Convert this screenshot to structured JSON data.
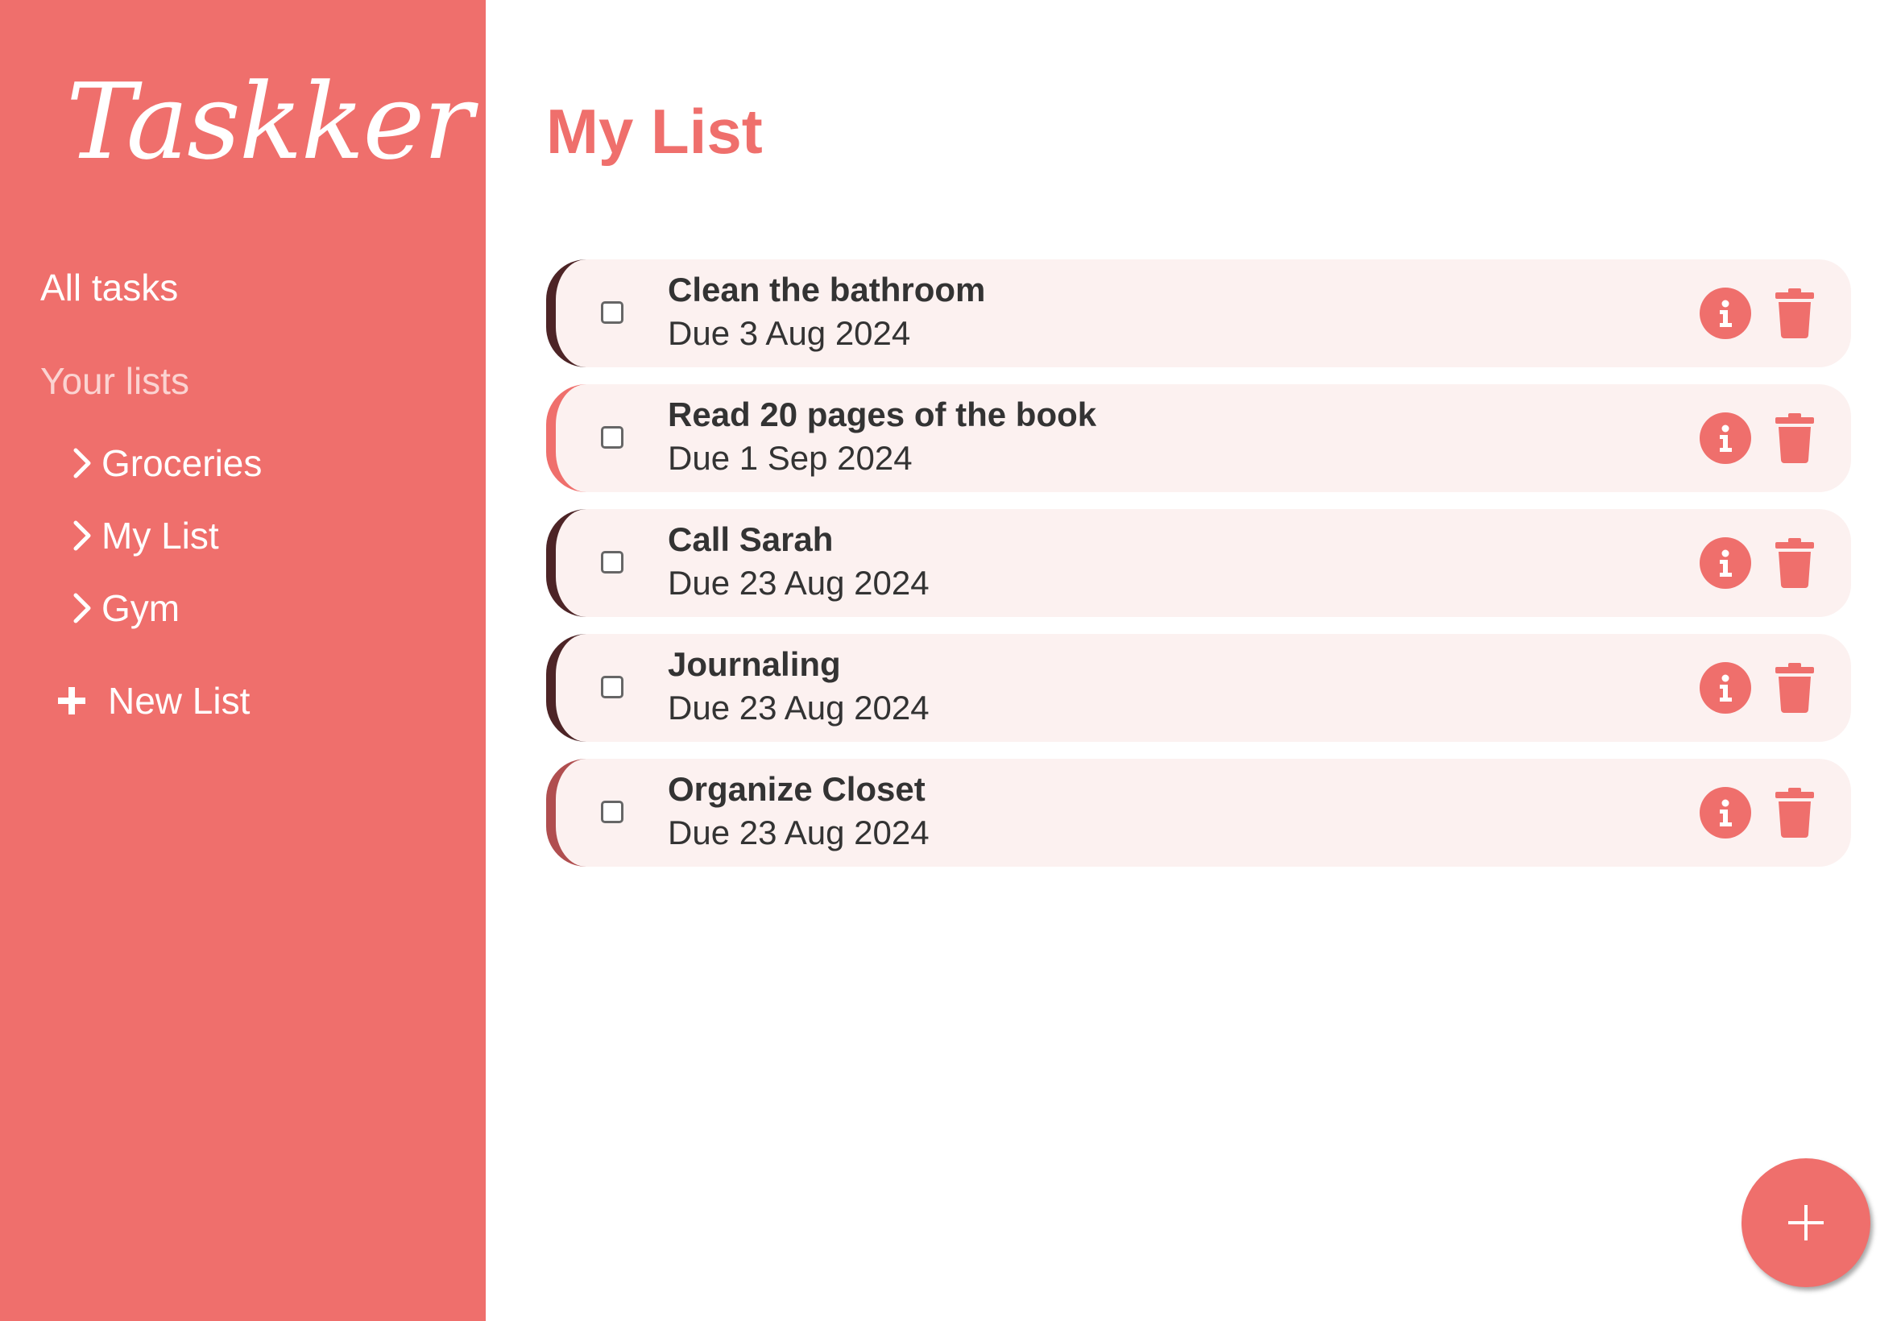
{
  "colors": {
    "brand": "#EF6F6C",
    "sidebar_bg": "#EF6F6C",
    "card_bg": "#FCF1F0",
    "text": "#333333"
  },
  "sidebar": {
    "logo": "Taskker",
    "all_tasks_label": "All tasks",
    "lists_heading": "Your lists",
    "lists": [
      {
        "label": "Groceries",
        "icon": "chevron-right-icon"
      },
      {
        "label": "My List",
        "icon": "chevron-right-icon"
      },
      {
        "label": "Gym",
        "icon": "chevron-right-icon"
      }
    ],
    "new_list_label": "New List",
    "new_list_icon": "plus-icon"
  },
  "main": {
    "title": "My List",
    "tasks": [
      {
        "name": "Clean the bathroom",
        "due": "Due 3 Aug 2024",
        "accent": "#4D2426",
        "checked": false
      },
      {
        "name": "Read 20 pages of the book",
        "due": "Due 1 Sep 2024",
        "accent": "#EF6F6C",
        "checked": false
      },
      {
        "name": "Call Sarah",
        "due": "Due 23 Aug 2024",
        "accent": "#4D2426",
        "checked": false
      },
      {
        "name": "Journaling",
        "due": "Due 23 Aug 2024",
        "accent": "#4D2426",
        "checked": false
      },
      {
        "name": "Organize Closet",
        "due": "Due 23 Aug 2024",
        "accent": "#B04E4F",
        "checked": false
      }
    ],
    "task_icons": {
      "info": "info-icon",
      "delete": "trash-icon"
    },
    "fab_icon": "plus-icon"
  }
}
